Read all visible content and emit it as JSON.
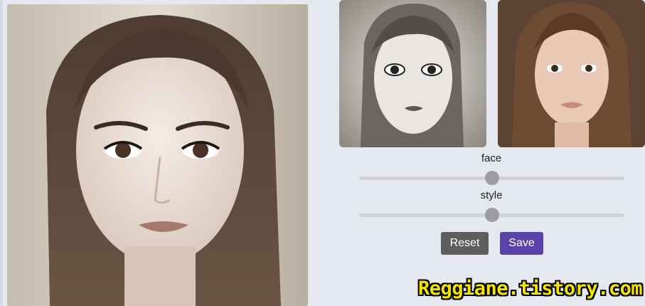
{
  "images": {
    "main": "generated-portrait-result",
    "style_reference": "grayscale-illustrated-style-portrait",
    "face_reference": "face-photo-portrait"
  },
  "sliders": [
    {
      "label": "face",
      "value_fraction": 0.5
    },
    {
      "label": "style",
      "value_fraction": 0.5
    }
  ],
  "buttons": {
    "reset": "Reset",
    "save": "Save"
  },
  "watermark": "Reggiane.tistory.com",
  "colors": {
    "background": "#e5e8ef",
    "reset_button": "#5e5e5e",
    "save_button": "#5943a6",
    "watermark": "#f2e400"
  }
}
